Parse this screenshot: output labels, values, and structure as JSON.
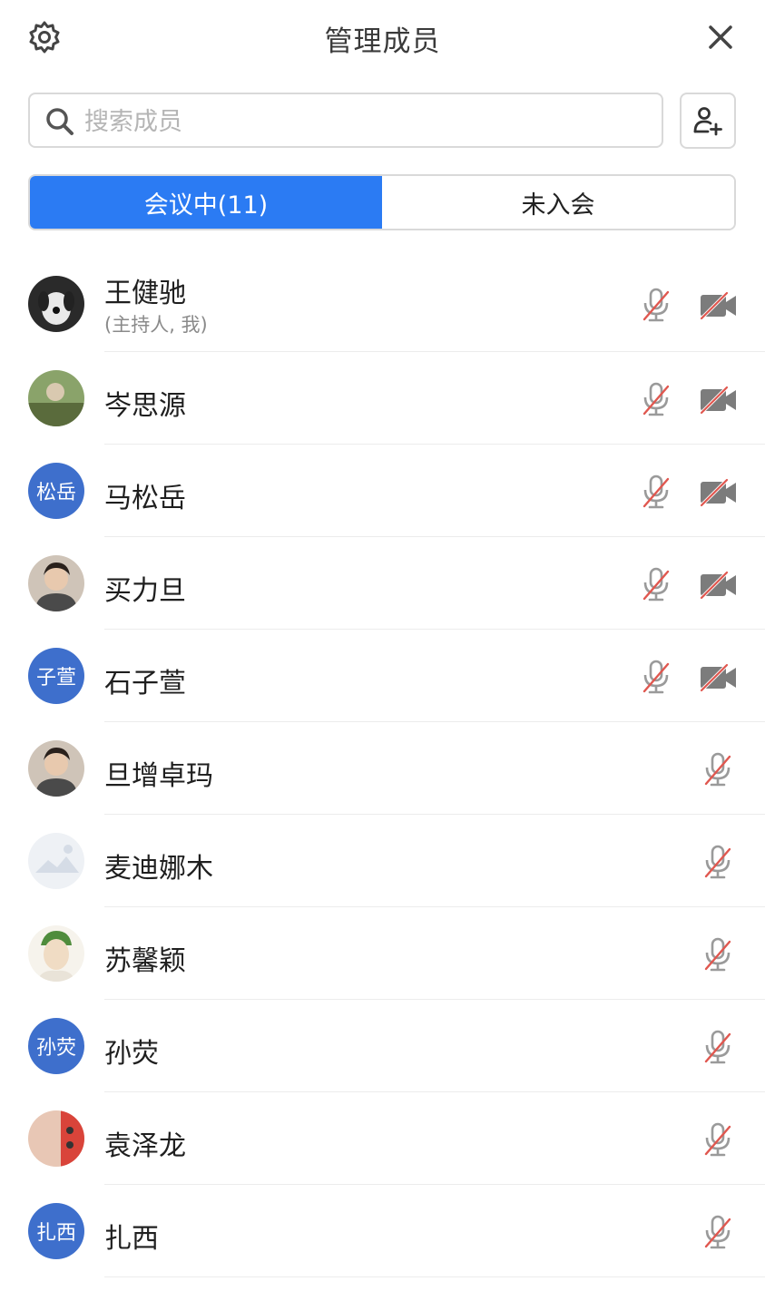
{
  "header": {
    "title": "管理成员",
    "settings_icon": "gear-icon",
    "close_icon": "close-icon"
  },
  "search": {
    "placeholder": "搜索成员",
    "value": "",
    "icon": "search-icon"
  },
  "add_member_icon": "add-user-icon",
  "tabs": [
    {
      "label": "会议中(11)",
      "active": true
    },
    {
      "label": "未入会",
      "active": false
    }
  ],
  "colors": {
    "accent": "#2b7bf3",
    "avatar_text_bg": "#3e6fcc",
    "muted_red": "#e0574f",
    "icon_gray": "#9a9a9a"
  },
  "members": [
    {
      "name": "王健驰",
      "sub": "(主持人, 我)",
      "avatar": {
        "type": "image",
        "desc": "plush-dog"
      },
      "mic": "muted",
      "camera": "off"
    },
    {
      "name": "岑思源",
      "avatar": {
        "type": "image",
        "desc": "photo"
      },
      "mic": "muted",
      "camera": "off"
    },
    {
      "name": "马松岳",
      "avatar": {
        "type": "text",
        "text": "松岳"
      },
      "mic": "muted",
      "camera": "off"
    },
    {
      "name": "买力旦",
      "avatar": {
        "type": "image",
        "desc": "portrait"
      },
      "mic": "muted",
      "camera": "off"
    },
    {
      "name": "石子萱",
      "avatar": {
        "type": "text",
        "text": "子萱"
      },
      "mic": "muted",
      "camera": "off"
    },
    {
      "name": "旦增卓玛",
      "avatar": {
        "type": "image",
        "desc": "portrait"
      },
      "mic": "muted",
      "camera": null
    },
    {
      "name": "麦迪娜木",
      "avatar": {
        "type": "image",
        "desc": "placeholder"
      },
      "mic": "muted",
      "camera": null
    },
    {
      "name": "苏馨颖",
      "avatar": {
        "type": "image",
        "desc": "anime"
      },
      "mic": "muted",
      "camera": null
    },
    {
      "name": "孙荧",
      "avatar": {
        "type": "text",
        "text": "孙荧"
      },
      "mic": "muted",
      "camera": null
    },
    {
      "name": "袁泽龙",
      "avatar": {
        "type": "image",
        "desc": "photo"
      },
      "mic": "muted",
      "camera": null
    },
    {
      "name": "扎西",
      "avatar": {
        "type": "text",
        "text": "扎西"
      },
      "mic": "muted",
      "camera": null
    }
  ]
}
